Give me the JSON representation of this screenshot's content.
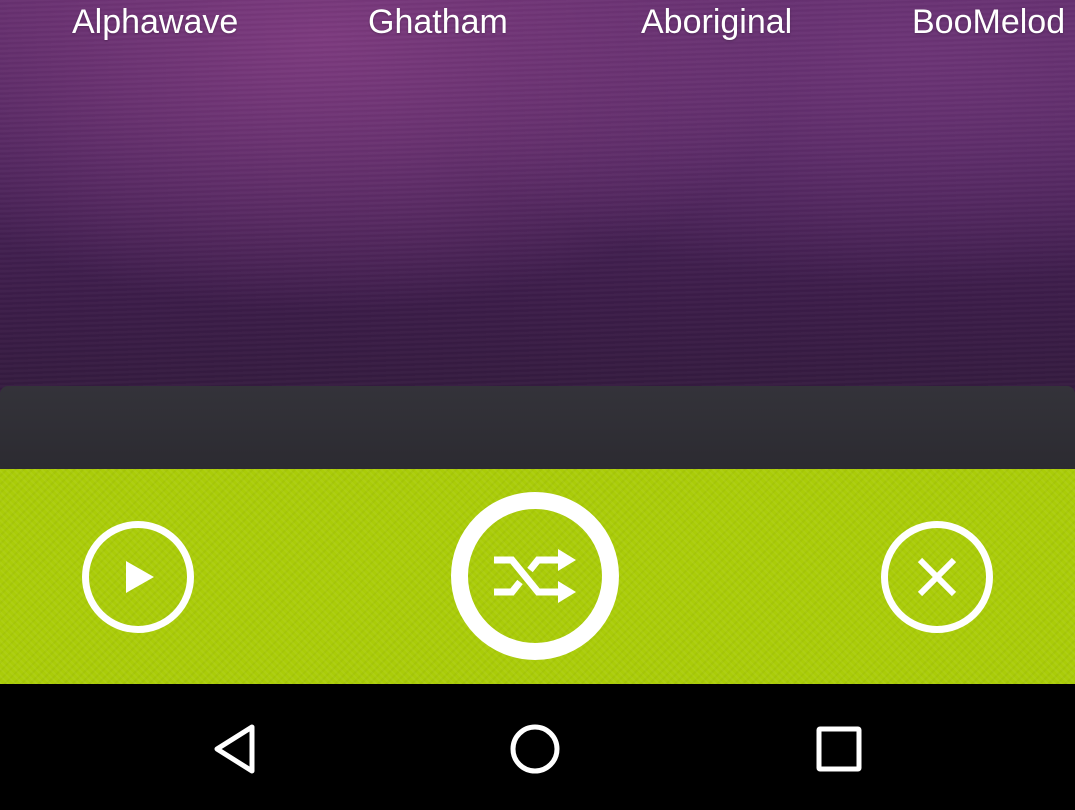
{
  "tabs": [
    {
      "label": "Alphawave"
    },
    {
      "label": "Ghatham"
    },
    {
      "label": "Aboriginal"
    },
    {
      "label": "BooMelod"
    }
  ],
  "controls": {
    "play_icon": "play-icon",
    "shuffle_icon": "shuffle-icon",
    "close_icon": "close-icon"
  },
  "nav": {
    "back_icon": "back-triangle-icon",
    "home_icon": "home-circle-icon",
    "recent_icon": "recent-apps-square-icon"
  },
  "colors": {
    "accent_green": "#aacc08",
    "background_purple": "#4a2359",
    "panel_dark": "#2f2e34",
    "nav_black": "#000000",
    "icon_white": "#ffffff"
  }
}
